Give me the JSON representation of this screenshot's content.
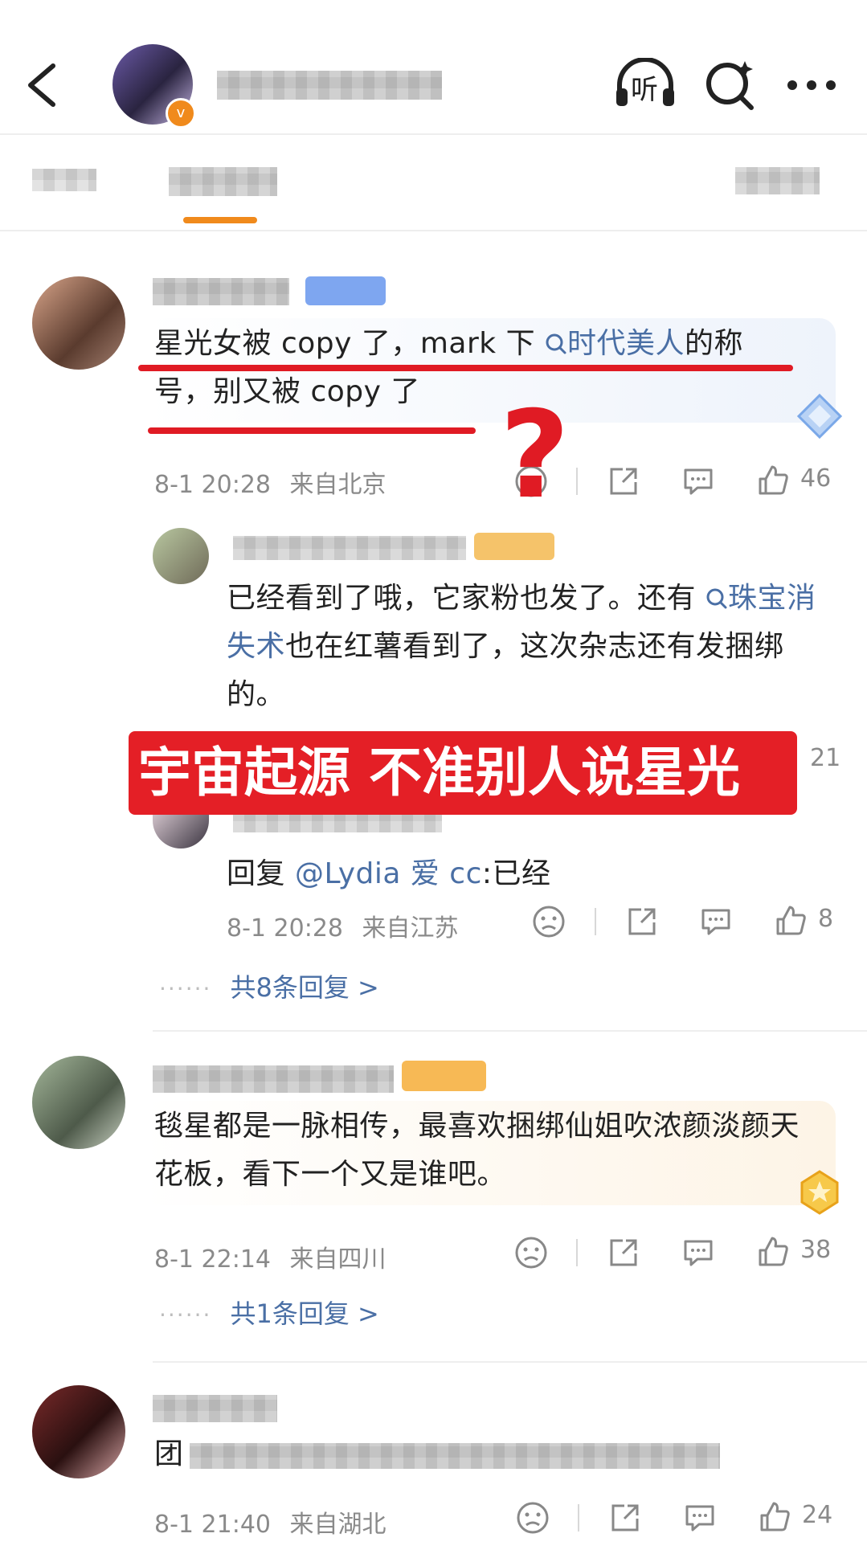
{
  "header": {
    "back_icon": "chevron-left-icon",
    "listen_label": "听",
    "search_icon": "search-sparkle-icon",
    "more_icon": "more-icon"
  },
  "tabs": [
    "",
    "",
    ""
  ],
  "comments": [
    {
      "text_a": "星光女被 copy 了，mark 下 ",
      "link_a": "时代美人",
      "text_b": "的称号，别又被 copy 了",
      "time": "8-1 20:28",
      "location": "来自北京",
      "likes": "46"
    },
    {
      "text_a": "毯星都是一脉相传，最喜欢捆绑仙姐吹浓颜淡颜天花板，看下一个又是谁吧。",
      "time": "8-1 22:14",
      "location": "来自四川",
      "likes": "38",
      "replies_label": "共1条回复 >"
    },
    {
      "text_a": "团",
      "time": "8-1 21:40",
      "location": "来自湖北",
      "likes": "24"
    }
  ],
  "reply1": {
    "text_a": "已经看到了哦，它家粉也发了。还有 ",
    "link_a": "珠宝消失术",
    "text_b": "也在红薯看到了，这次杂志还有发捆绑的。",
    "likes": "21"
  },
  "reply2": {
    "prefix": "回复 ",
    "mention": "@Lydia 爱 cc",
    "suffix": ":已经",
    "time": "8-1 20:28",
    "location": "来自江苏",
    "likes": "8"
  },
  "replies_summary_1": "共8条回复 >",
  "overlay": {
    "question_mark": "?",
    "banner": "宇宙起源 不准别人说星光"
  }
}
